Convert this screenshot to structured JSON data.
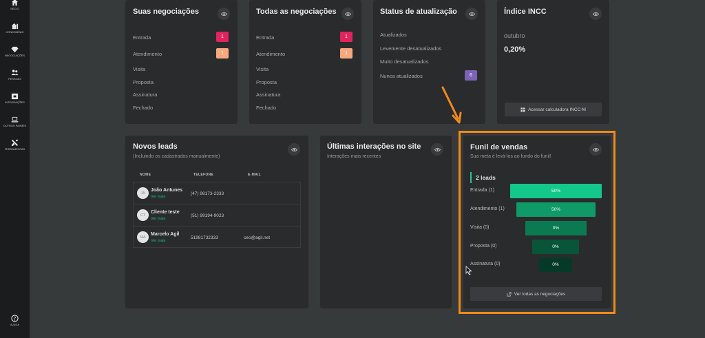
{
  "sidebar": {
    "items": [
      {
        "label": "INÍCIO",
        "icon": "home-icon"
      },
      {
        "label": "CONDOMÍNIO",
        "icon": "building-home-icon"
      },
      {
        "label": "NEGOCIAÇÕES",
        "icon": "diamond-icon"
      },
      {
        "label": "PESSOAS",
        "icon": "people-icon"
      },
      {
        "label": "INTEGRAÇÕES",
        "icon": "integration-icon"
      },
      {
        "label": "OUTROS PAINÉIS",
        "icon": "laptop-icon"
      },
      {
        "label": "FERRAMENTAS",
        "icon": "tools-icon"
      }
    ],
    "help": {
      "label": "AJUDA",
      "icon": "help-icon"
    }
  },
  "suas": {
    "title": "Suas negociações",
    "rows": [
      {
        "label": "Entrada",
        "count": "1"
      },
      {
        "label": "Atendimento",
        "count": "1"
      },
      {
        "label": "Visita"
      },
      {
        "label": "Proposta"
      },
      {
        "label": "Assinatura"
      },
      {
        "label": "Fechado"
      }
    ]
  },
  "todas": {
    "title": "Todas as negociações",
    "rows": [
      {
        "label": "Entrada",
        "count": "1"
      },
      {
        "label": "Atendimento",
        "count": "1"
      },
      {
        "label": "Visita"
      },
      {
        "label": "Proposta"
      },
      {
        "label": "Assinatura"
      },
      {
        "label": "Fechado"
      }
    ]
  },
  "status": {
    "title": "Status de atualização",
    "rows": [
      {
        "label": "Atualizados"
      },
      {
        "label": "Levemente desatualizados"
      },
      {
        "label": "Muito desatualizados"
      },
      {
        "label": "Nunca atualizados",
        "count": "6"
      }
    ]
  },
  "incc": {
    "title": "Índice INCC",
    "month": "outubro",
    "value": "0,20%",
    "button": "Acessar calculadora INCC-M"
  },
  "leads": {
    "title": "Novos leads",
    "subtitle": "(Incluindo os cadastrados manualmente)",
    "columns": [
      "NOME",
      "TELEFONE",
      "E-MAIL"
    ],
    "rows": [
      {
        "initials": "JA",
        "name": "João Antunes",
        "link": "Ver mais",
        "phone": "(47) 98173-2333",
        "email": ""
      },
      {
        "initials": "CT",
        "name": "Cliente teste",
        "link": "Ver mais",
        "phone": "(51) 99194-9023",
        "email": ""
      },
      {
        "initials": "MA",
        "name": "Marcelo Agil",
        "link": "Ver mais",
        "phone": "51981732333",
        "email": "ceo@agil.net"
      }
    ]
  },
  "interacoes": {
    "title": "Últimas interações no site",
    "subtitle": "Interações mais recentes"
  },
  "funil": {
    "title": "Funil de vendas",
    "subtitle": "Sua meta é levá-los ao fundo do funil!",
    "leads_count": "2 leads",
    "stages": [
      {
        "label": "Entrada (1)",
        "pct": "50%",
        "color": "#14c78a"
      },
      {
        "label": "Atendimento (1)",
        "pct": "50%",
        "color": "#0f9a68"
      },
      {
        "label": "Visita (0)",
        "pct": "0%",
        "color": "#0b7a52"
      },
      {
        "label": "Proposta (0)",
        "pct": "0%",
        "color": "#08553a"
      },
      {
        "label": "Assinatura (0)",
        "pct": "0%",
        "color": "#063a28"
      }
    ],
    "button": "Ver todas as negociações"
  },
  "colors": {
    "badge_entrada": "#e0245e",
    "badge_atendimento": "#f7a87e",
    "badge_nunca": "#7b63b5",
    "highlight": "#f18a1c",
    "accent_green": "#18c58b"
  }
}
